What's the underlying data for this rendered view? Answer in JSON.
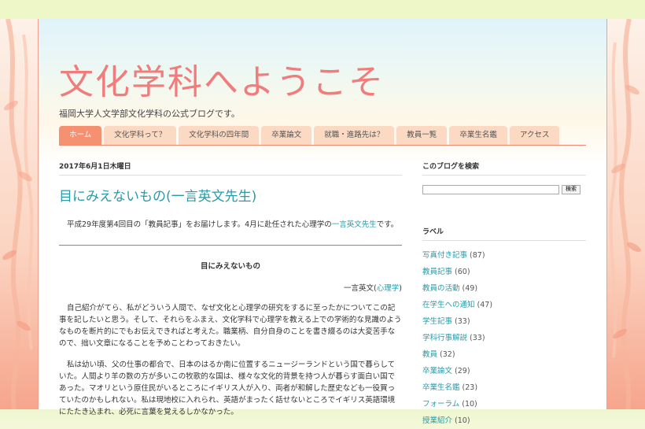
{
  "header": {
    "title": "文化学科へようこそ",
    "description": "福岡大学人文学部文化学科の公式ブログです。"
  },
  "nav": {
    "tabs": [
      {
        "label": "ホーム",
        "active": true
      },
      {
        "label": "文化学科って？"
      },
      {
        "label": "文化学科の四年間"
      },
      {
        "label": "卒業論文"
      },
      {
        "label": "就職・進路先は？"
      },
      {
        "label": "教員一覧"
      },
      {
        "label": "卒業生名鑑"
      },
      {
        "label": "アクセス"
      }
    ]
  },
  "post": {
    "date": "2017年6月1日木曜日",
    "title": "目にみえないもの(一言英文先生)",
    "intro_before": "平成29年度第4回目の「教員記事」をお届けします。4月に赴任された心理学の",
    "intro_link": "一言英文先生",
    "intro_after": "です。",
    "subtitle": "目にみえないもの",
    "author_name": "一言英文(",
    "author_link": "心理学",
    "author_close": ")",
    "paragraphs": [
      "自己紹介がてら、私がどういう人間で、なぜ文化と心理学の研究をするに至ったかについてこの記事を記したいと思う。そして、それらをふまえ、文化学科で心理学を教える上での学術的な見識のようなものを断片的にでもお伝えできればと考えた。職業柄、自分自身のことを書き綴るのは大変苦手なので、拙い文章になることを予めことわっておきたい。",
      "私は幼い頃、父の仕事の都合で、日本のはるか南に位置するニュージーランドという国で暮らしていた。人間より羊の数の方が多いこの牧歌的な国は、様々な文化的背景を持つ人が暮らす面白い国であった。マオリという原住民がいるところにイギリス人が入り、両者が和解した歴史なども一役買っていたのかもしれない。私は現地校に入れられ、英語がまったく話せないところでイギリス英語環境にたたき込まれ、必死に言葉を覚えるしかなかった。"
    ]
  },
  "sidebar": {
    "search_title": "このブログを検索",
    "search_placeholder": "",
    "search_button": "検索",
    "labels_title": "ラベル",
    "labels": [
      {
        "name": "写真付き記事",
        "count": "(87)"
      },
      {
        "name": "教員記事",
        "count": "(60)"
      },
      {
        "name": "教員の活動",
        "count": "(49)"
      },
      {
        "name": "在学生への通知",
        "count": "(47)"
      },
      {
        "name": "学生記事",
        "count": "(33)"
      },
      {
        "name": "学科行事解説",
        "count": "(33)"
      },
      {
        "name": "教員",
        "count": "(32)"
      },
      {
        "name": "卒業論文",
        "count": "(29)"
      },
      {
        "name": "卒業生名鑑",
        "count": "(23)"
      },
      {
        "name": "フォーラム",
        "count": "(10)"
      },
      {
        "name": "授業紹介",
        "count": "(10)"
      }
    ]
  },
  "colors": {
    "title": "#f07c7c",
    "link": "#2a9aa8",
    "tab_active": "#f59070",
    "tab": "#fcd9c2"
  }
}
